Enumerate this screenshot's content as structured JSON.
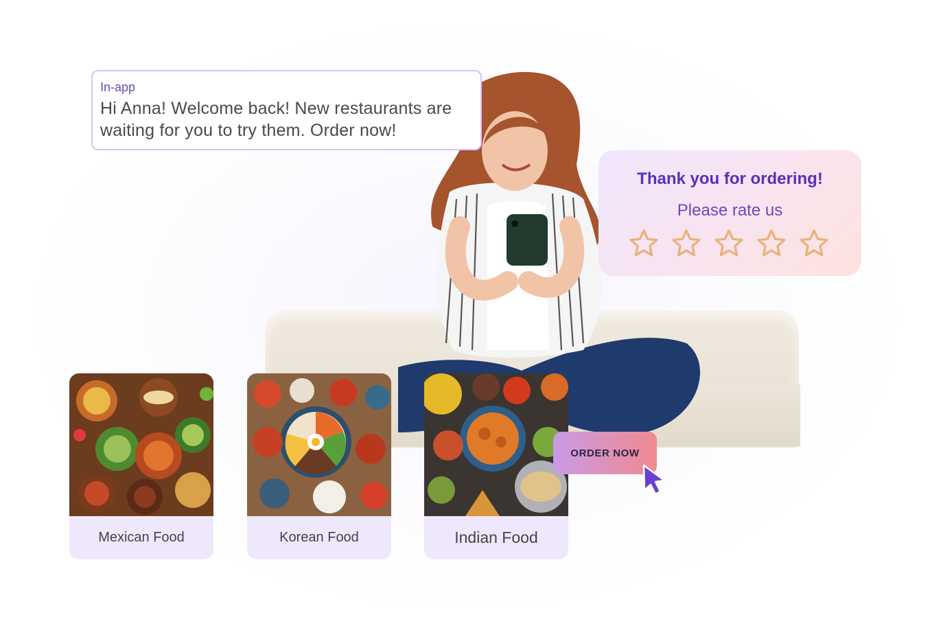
{
  "in_app": {
    "label": "In-app",
    "message_line1": "Hi Anna! Welcome back! New restaurants are",
    "message_line2": "waiting for you to try them. Order now!"
  },
  "rating": {
    "title": "Thank you for ordering!",
    "subtitle": "Please rate us",
    "rating_value": 0,
    "max_stars": 5,
    "star_color": "#e8b47e"
  },
  "food_cards": [
    {
      "label": "Mexican Food"
    },
    {
      "label": "Korean Food"
    },
    {
      "label": "Indian Food"
    }
  ],
  "cta": {
    "label": "ORDER NOW",
    "gradient_from": "#c99be6",
    "gradient_to": "#f08a8e"
  },
  "colors": {
    "brand_purple": "#5a2fbf",
    "cursor_purple": "#6a3fd0"
  },
  "icons": [
    "star-icon",
    "cursor-icon"
  ]
}
